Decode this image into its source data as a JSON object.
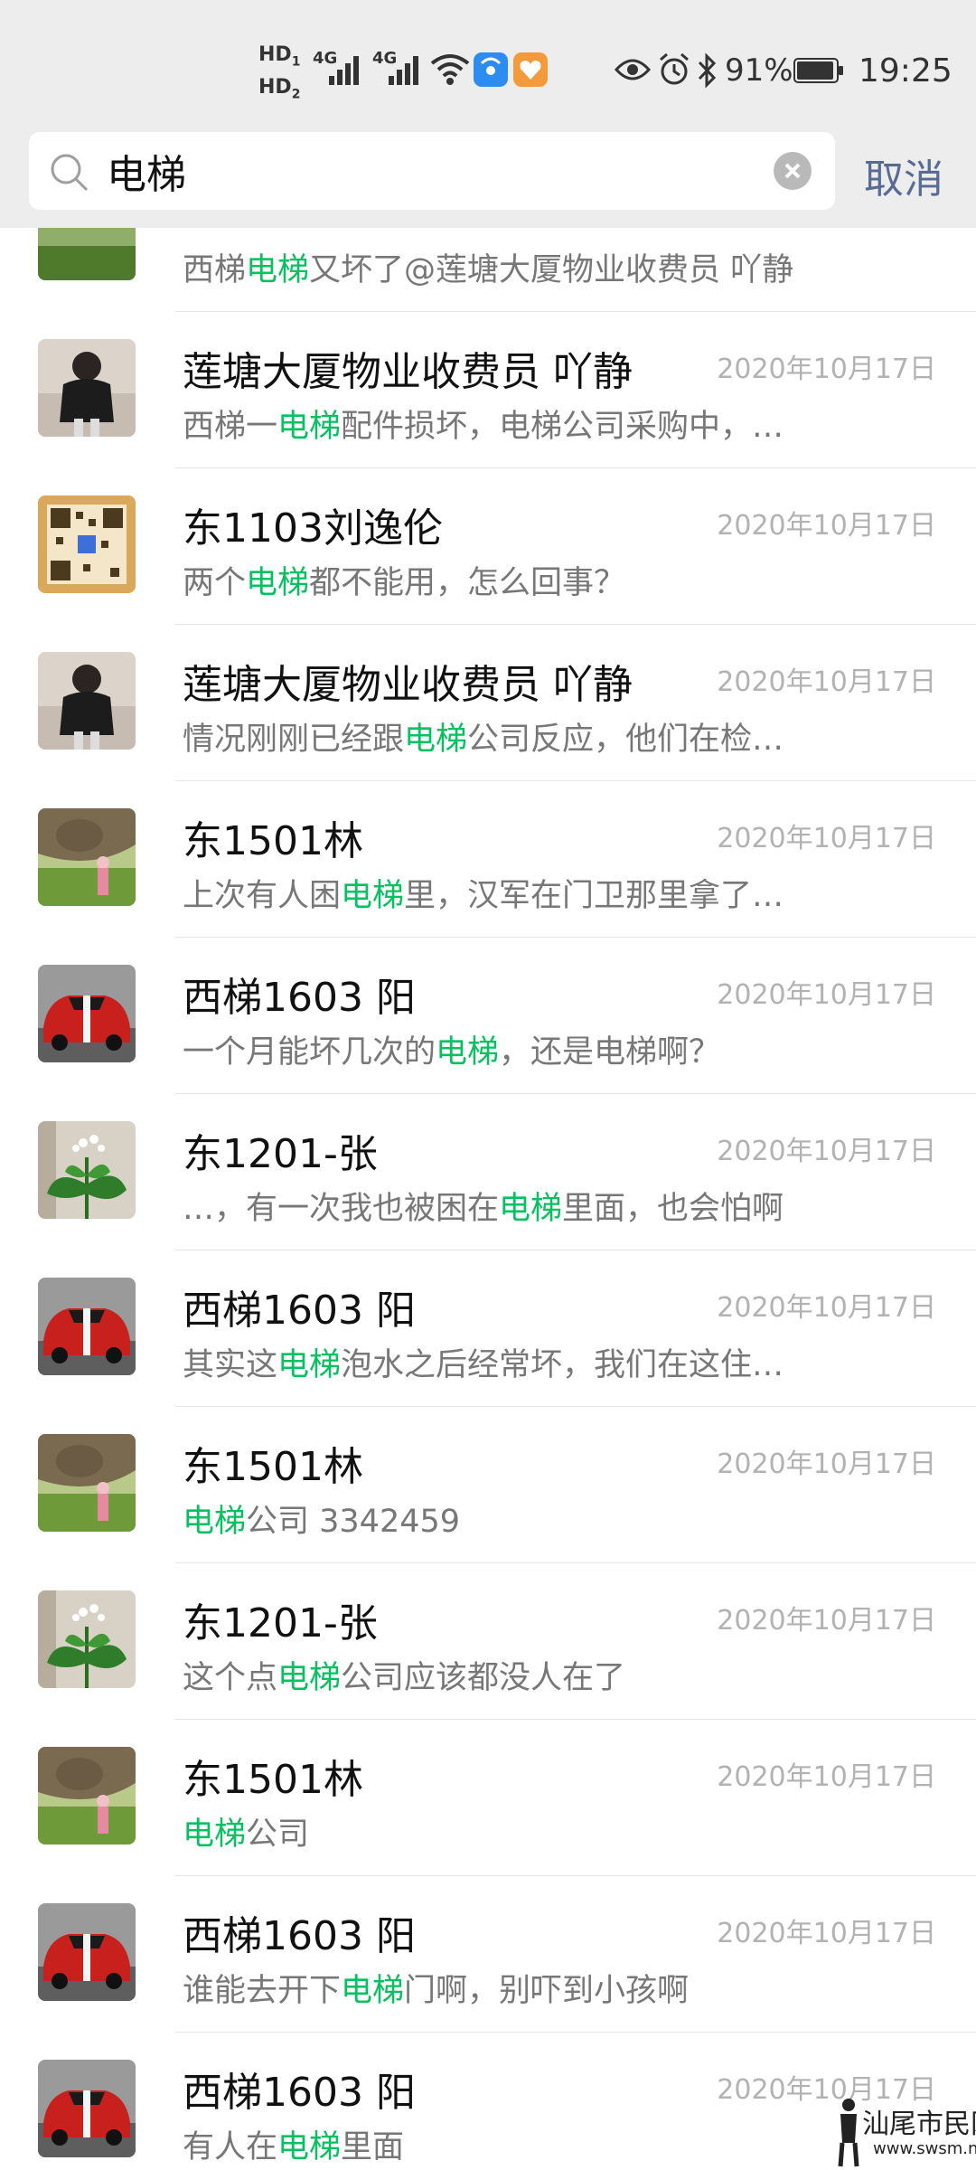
{
  "status_bar": {
    "hd1": "HD",
    "hd2": "HD",
    "network1": "4G",
    "network2": "4G",
    "battery": "91%",
    "time": "19:25",
    "icons": [
      "hd-icon",
      "signal-icon",
      "wifi-icon",
      "app-badge-icon",
      "eye-icon",
      "alarm-icon",
      "bluetooth-icon",
      "battery-icon"
    ]
  },
  "search": {
    "query": "电梯",
    "cancel_label": "取消"
  },
  "colors": {
    "highlight": "#07c160",
    "cancel": "#576b95",
    "date": "#b2b2b2"
  },
  "partial_row": {
    "prefix": "西梯",
    "hl": "电梯",
    "suffix": "又坏了@莲塘大厦物业收费员 吖静"
  },
  "results": [
    {
      "name": "莲塘大厦物业收费员  吖静",
      "date": "2020年10月17日",
      "pre": "西梯一",
      "hl": "电梯",
      "post": "配件损坏，电梯公司采购中，…",
      "avatar": "person-black"
    },
    {
      "name": "东1103刘逸伦",
      "date": "2020年10月17日",
      "pre": "两个",
      "hl": "电梯",
      "post": "都不能用，怎么回事？",
      "avatar": "qr-code"
    },
    {
      "name": "莲塘大厦物业收费员  吖静",
      "date": "2020年10月17日",
      "pre": "情况刚刚已经跟",
      "hl": "电梯",
      "post": "公司反应，他们在检…",
      "avatar": "person-black"
    },
    {
      "name": "东1501林",
      "date": "2020年10月17日",
      "pre": "上次有人困",
      "hl": "电梯",
      "post": "里，汉军在门卫那里拿了…",
      "avatar": "mural"
    },
    {
      "name": "西梯1603 阳",
      "date": "2020年10月17日",
      "pre": "一个月能坏几次的",
      "hl": "电梯",
      "post": "，还是电梯啊？",
      "avatar": "red-car"
    },
    {
      "name": "东1201-张",
      "date": "2020年10月17日",
      "pre": "…，有一次我也被困在",
      "hl": "电梯",
      "post": "里面，也会怕啊",
      "avatar": "plant"
    },
    {
      "name": "西梯1603 阳",
      "date": "2020年10月17日",
      "pre": "其实这",
      "hl": "电梯",
      "post": "泡水之后经常坏，我们在这住…",
      "avatar": "red-car"
    },
    {
      "name": "东1501林",
      "date": "2020年10月17日",
      "pre": "",
      "hl": "电梯",
      "post": "公司 3342459",
      "avatar": "mural"
    },
    {
      "name": "东1201-张",
      "date": "2020年10月17日",
      "pre": "这个点",
      "hl": "电梯",
      "post": "公司应该都没人在了",
      "avatar": "plant"
    },
    {
      "name": "东1501林",
      "date": "2020年10月17日",
      "pre": "",
      "hl": "电梯",
      "post": "公司",
      "avatar": "mural"
    },
    {
      "name": "西梯1603 阳",
      "date": "2020年10月17日",
      "pre": "谁能去开下",
      "hl": "电梯",
      "post": "门啊，别吓到小孩啊",
      "avatar": "red-car"
    },
    {
      "name": "西梯1603 阳",
      "date": "2020年10月17日",
      "pre": "有人在",
      "hl": "电梯",
      "post": "里面",
      "avatar": "red-car"
    }
  ],
  "watermark": {
    "text": "汕尾市民网",
    "url": "www.swsm.net"
  }
}
